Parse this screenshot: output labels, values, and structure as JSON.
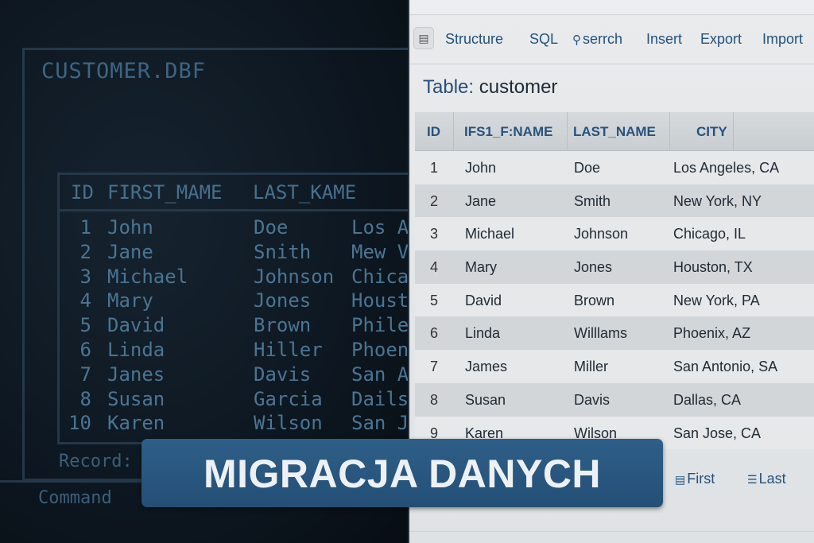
{
  "terminal": {
    "title": "CUSTOMER.DBF",
    "columns": [
      "ID",
      "FIRST_MAME",
      "LAST_KAME"
    ],
    "rows": [
      {
        "id": "1",
        "first": "John",
        "last": "Doe",
        "city": "Los A"
      },
      {
        "id": "2",
        "first": "Jane",
        "last": "Snith",
        "city": "Mew V"
      },
      {
        "id": "3",
        "first": "Michael",
        "last": "Johnson",
        "city": "Chica"
      },
      {
        "id": "4",
        "first": "Mary",
        "last": "Jones",
        "city": "Houst"
      },
      {
        "id": "5",
        "first": "David",
        "last": "Brown",
        "city": "Phile"
      },
      {
        "id": "6",
        "first": "Linda",
        "last": "Hiller",
        "city": "Phoen"
      },
      {
        "id": "7",
        "first": "Janes",
        "last": "Davis",
        "city": "San A"
      },
      {
        "id": "8",
        "first": "Susan",
        "last": "Garcia",
        "city": "Dails"
      },
      {
        "id": "10",
        "first": "Karen",
        "last": "Wilson",
        "city": "San J"
      }
    ],
    "record_label": "Record:",
    "command_label": "Command"
  },
  "web": {
    "toolbar": {
      "structure": "Structure",
      "sql": "SQL",
      "search": "serrch",
      "insert": "Insert",
      "export": "Export",
      "import": "Import"
    },
    "title_prefix": "Table:",
    "title_name": "customer",
    "columns": [
      "ID",
      "IFS1_F:NAME",
      "LAST_NAME",
      "CITY"
    ],
    "rows": [
      {
        "id": "1",
        "first": "John",
        "last": "Doe",
        "city": "Los Angeles, CA"
      },
      {
        "id": "2",
        "first": "Jane",
        "last": "Smith",
        "city": "New York, NY"
      },
      {
        "id": "3",
        "first": "Michael",
        "last": "Johnson",
        "city": "Chicago, IL"
      },
      {
        "id": "4",
        "first": "Mary",
        "last": "Jones",
        "city": "Houston, TX"
      },
      {
        "id": "5",
        "first": "David",
        "last": "Brown",
        "city": "New York, PA"
      },
      {
        "id": "6",
        "first": "Linda",
        "last": "Willlams",
        "city": "Phoenix, AZ"
      },
      {
        "id": "7",
        "first": "James",
        "last": "Miller",
        "city": "San Antonio, SA"
      },
      {
        "id": "8",
        "first": "Susan",
        "last": "Davis",
        "city": "Dallas, CA"
      },
      {
        "id": "9",
        "first": "Karen",
        "last": "Wilson",
        "city": "San Jose, CA"
      }
    ],
    "pager": {
      "first": "First",
      "last": "Last"
    }
  },
  "banner": {
    "text": "MIGRACJA DANYCH"
  },
  "icons": {
    "toolbar_icon": "table-icon",
    "search_icon": "magnifier-icon",
    "first_icon": "first-page-icon",
    "last_icon": "last-page-icon"
  },
  "colors": {
    "banner_bg": "#2a5a83",
    "link": "#23527c",
    "terminal_text": "#4a7594",
    "terminal_bg": "#0e1822"
  }
}
